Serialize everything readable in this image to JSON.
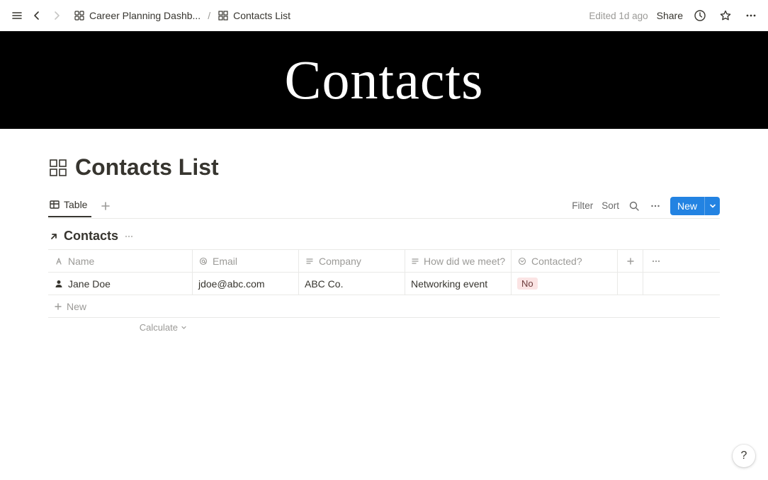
{
  "topbar": {
    "breadcrumb_parent": "Career Planning Dashb...",
    "breadcrumb_sep": "/",
    "breadcrumb_current": "Contacts List",
    "edited": "Edited 1d ago",
    "share": "Share"
  },
  "cover": {
    "title": "Contacts"
  },
  "page": {
    "title": "Contacts List"
  },
  "view": {
    "tab_label": "Table",
    "filter": "Filter",
    "sort": "Sort",
    "new_label": "New"
  },
  "db": {
    "title": "Contacts"
  },
  "columns": {
    "name": "Name",
    "email": "Email",
    "company": "Company",
    "how": "How did we meet?",
    "contacted": "Contacted?"
  },
  "rows": [
    {
      "name": "Jane Doe",
      "email": "jdoe@abc.com",
      "company": "ABC Co.",
      "how": "Networking event",
      "contacted_tag": "No"
    }
  ],
  "new_row": "New",
  "calc": "Calculate",
  "help": "?"
}
